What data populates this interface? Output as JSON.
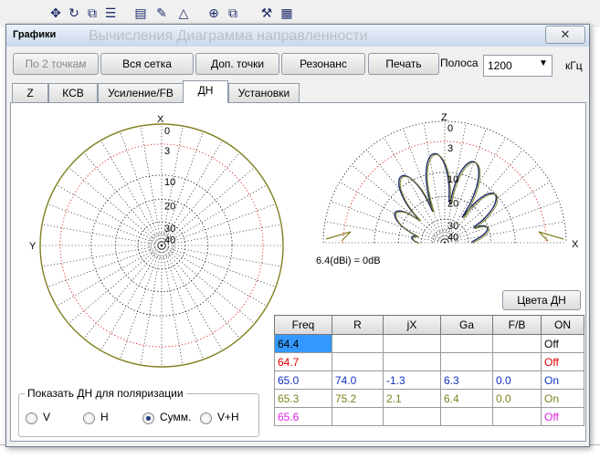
{
  "toolbar": {
    "icons": [
      "move-icon",
      "rotate-icon",
      "open-list-icon",
      "scale-icon",
      "document-icon",
      "draw-icon",
      "triangle-icon",
      "crosshair-icon",
      "copy-icon",
      "tools-icon",
      "calculator-icon"
    ]
  },
  "dialog": {
    "title": "Графики",
    "background_title": "Вычисления  Диаграмма направленности",
    "close_label": "✕"
  },
  "buttons": {
    "by_two_points": "По 2 точкам",
    "full_grid": "Вся сетка",
    "extra_points": "Доп. точки",
    "resonance": "Резонанс",
    "print": "Печать",
    "pattern_colors": "Цвета ДН"
  },
  "band": {
    "label": "Полоса",
    "value": "1200",
    "unit": "кГц"
  },
  "tabs": [
    "Z",
    "КСВ",
    "Усиление/FB",
    "ДН",
    "Установки"
  ],
  "active_tab": "ДН",
  "plots": {
    "azimuth": {
      "top_axis": "X",
      "left_axis": "Y",
      "ring_labels": [
        "0",
        "3",
        "10",
        "20",
        "30",
        "40"
      ]
    },
    "elevation": {
      "top_axis": "Z",
      "right_axis": "X",
      "ring_labels": [
        "0",
        "3",
        "10",
        "20",
        "30",
        "40"
      ]
    },
    "reference": "6.4(dBi) = 0dB"
  },
  "polarization": {
    "legend": "Показать ДН для поляризации",
    "options": [
      "V",
      "H",
      "Сумм.",
      "V+H"
    ],
    "selected": "Сумм."
  },
  "table": {
    "headers": [
      "Freq",
      "R",
      "jX",
      "Ga",
      "F/B",
      "ON"
    ],
    "rows": [
      {
        "freq": "64.4",
        "r": "",
        "jx": "",
        "ga": "",
        "fb": "",
        "on": "Off",
        "color": "#000000",
        "on_color": "#000000",
        "selected": true
      },
      {
        "freq": "64.7",
        "r": "",
        "jx": "",
        "ga": "",
        "fb": "",
        "on": "Off",
        "color": "#e00000",
        "on_color": "#e00000",
        "selected": false
      },
      {
        "freq": "65.0",
        "r": "74.0",
        "jx": "-1.3",
        "ga": "6.3",
        "fb": "0.0",
        "on": "On",
        "color": "#1030c0",
        "on_color": "#1030c0",
        "selected": false
      },
      {
        "freq": "65.3",
        "r": "75.2",
        "jx": "2.1",
        "ga": "6.4",
        "fb": "0.0",
        "on": "On",
        "color": "#808020",
        "on_color": "#808020",
        "selected": false
      },
      {
        "freq": "65.6",
        "r": "",
        "jx": "",
        "ga": "",
        "fb": "",
        "on": "Off",
        "color": "#e020e0",
        "on_color": "#e020e0",
        "selected": false
      }
    ]
  },
  "colors": {
    "grid_dotted": "#000000",
    "minus3_ring": "#e00000",
    "pattern_outline": "#808020",
    "pattern_lobes": "#1a2a6a",
    "selection": "#3399ff"
  }
}
